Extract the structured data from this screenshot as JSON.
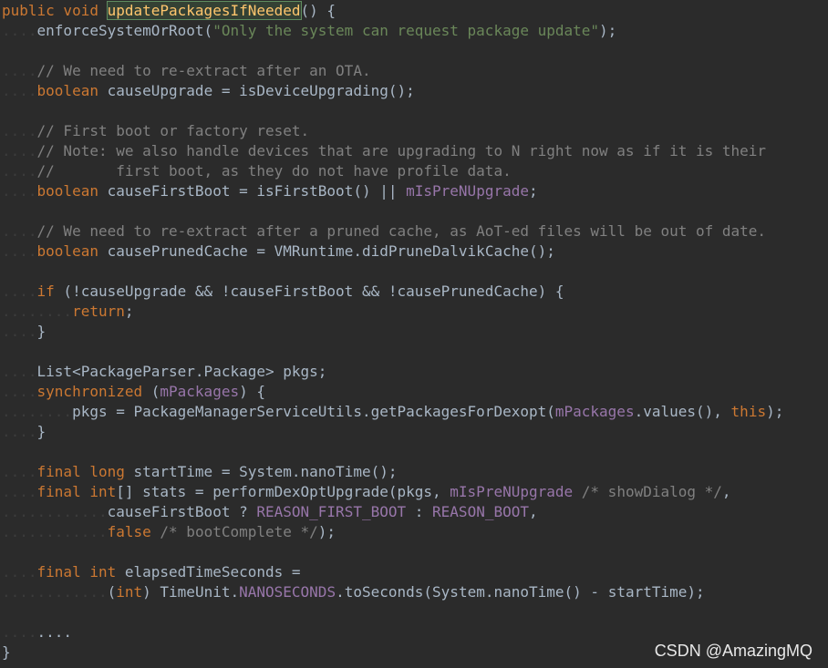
{
  "lines": [
    [
      {
        "t": "public void ",
        "c": "kw"
      },
      {
        "t": "updatePackagesIfNeeded",
        "c": "hl"
      },
      {
        "t": "() {"
      }
    ],
    [
      {
        "t": "    enforceSystemOrRoot("
      },
      {
        "t": "\"Only the system can request package update\"",
        "c": "str"
      },
      {
        "t": ");"
      }
    ],
    [],
    [
      {
        "t": "    // We need to re-extract after an OTA.",
        "c": "cmt"
      }
    ],
    [
      {
        "t": "    "
      },
      {
        "t": "boolean",
        "c": "kw"
      },
      {
        "t": " causeUpgrade = isDeviceUpgrading();"
      }
    ],
    [],
    [
      {
        "t": "    // First boot or factory reset.",
        "c": "cmt"
      }
    ],
    [
      {
        "t": "    // Note: we also handle devices that are upgrading to N right now as if it is their",
        "c": "cmt"
      }
    ],
    [
      {
        "t": "    //       first boot, as they do not have profile data.",
        "c": "cmt"
      }
    ],
    [
      {
        "t": "    "
      },
      {
        "t": "boolean",
        "c": "kw"
      },
      {
        "t": " causeFirstBoot = isFirstBoot() || "
      },
      {
        "t": "mIsPreNUpgrade",
        "c": "fld"
      },
      {
        "t": ";"
      }
    ],
    [],
    [
      {
        "t": "    // We need to re-extract after a pruned cache, as AoT-ed files will be out of date.",
        "c": "cmt"
      }
    ],
    [
      {
        "t": "    "
      },
      {
        "t": "boolean",
        "c": "kw"
      },
      {
        "t": " causePrunedCache = VMRuntime.didPruneDalvikCache();"
      }
    ],
    [],
    [
      {
        "t": "    "
      },
      {
        "t": "if",
        "c": "kw"
      },
      {
        "t": " (!causeUpgrade && !causeFirstBoot && !causePrunedCache) {"
      }
    ],
    [
      {
        "t": "        "
      },
      {
        "t": "return",
        "c": "kw"
      },
      {
        "t": ";"
      }
    ],
    [
      {
        "t": "    }"
      }
    ],
    [],
    [
      {
        "t": "    List<PackageParser.Package> pkgs;"
      }
    ],
    [
      {
        "t": "    "
      },
      {
        "t": "synchronized",
        "c": "kw"
      },
      {
        "t": " ("
      },
      {
        "t": "mPackages",
        "c": "fld"
      },
      {
        "t": ") {"
      }
    ],
    [
      {
        "t": "        pkgs = PackageManagerServiceUtils.getPackagesForDexopt("
      },
      {
        "t": "mPackages",
        "c": "fld"
      },
      {
        "t": ".values(), "
      },
      {
        "t": "this",
        "c": "kw"
      },
      {
        "t": ");"
      }
    ],
    [
      {
        "t": "    }"
      }
    ],
    [],
    [
      {
        "t": "    "
      },
      {
        "t": "final long",
        "c": "kw"
      },
      {
        "t": " startTime = System.nanoTime();"
      }
    ],
    [
      {
        "t": "    "
      },
      {
        "t": "final int",
        "c": "kw"
      },
      {
        "t": "[] stats = performDexOptUpgrade(pkgs, "
      },
      {
        "t": "mIsPreNUpgrade",
        "c": "fld"
      },
      {
        "t": " "
      },
      {
        "t": "/* showDialog */",
        "c": "cmt"
      },
      {
        "t": ","
      }
    ],
    [
      {
        "t": "            causeFirstBoot ? "
      },
      {
        "t": "REASON_FIRST_BOOT",
        "c": "fld"
      },
      {
        "t": " : "
      },
      {
        "t": "REASON_BOOT",
        "c": "fld"
      },
      {
        "t": ","
      }
    ],
    [
      {
        "t": "            "
      },
      {
        "t": "false",
        "c": "kw"
      },
      {
        "t": " "
      },
      {
        "t": "/* bootComplete */",
        "c": "cmt"
      },
      {
        "t": ");"
      }
    ],
    [],
    [
      {
        "t": "    "
      },
      {
        "t": "final int",
        "c": "kw"
      },
      {
        "t": " elapsedTimeSeconds ="
      }
    ],
    [
      {
        "t": "            ("
      },
      {
        "t": "int",
        "c": "kw"
      },
      {
        "t": ") TimeUnit."
      },
      {
        "t": "NANOSECONDS",
        "c": "fld"
      },
      {
        "t": ".toSeconds(System.nanoTime() - startTime);"
      }
    ],
    [],
    [
      {
        "t": "    ...."
      }
    ],
    [
      {
        "t": "}"
      }
    ]
  ],
  "watermark": "CSDN @AmazingMQ"
}
